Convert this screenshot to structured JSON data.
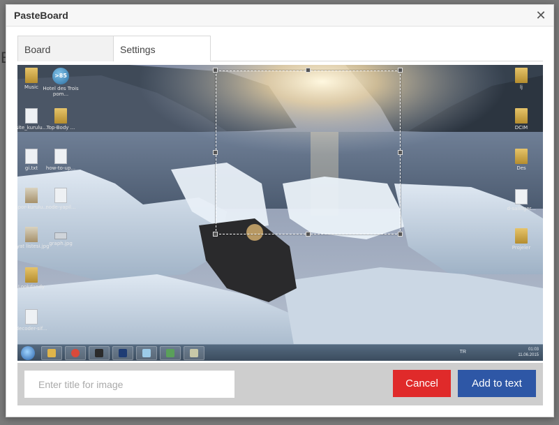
{
  "modal": {
    "title": "PasteBoard",
    "close_glyph": "✕"
  },
  "tabs": [
    {
      "label": "Board",
      "active": true
    },
    {
      "label": "Settings",
      "active": false
    }
  ],
  "desktop_icons": [
    {
      "label": "Music",
      "icon": "folder-icon"
    },
    {
      "label": "Hotel des Trois pom...",
      "icon": "app-icon"
    },
    {
      "label": "site_kurulu...",
      "icon": "file-icon"
    },
    {
      "label": "Top-Body ...",
      "icon": "folder-icon"
    },
    {
      "label": "gi.txt",
      "icon": "file-icon"
    },
    {
      "label": "how-to-up...",
      "icon": "file-icon"
    },
    {
      "label": "spor-kurulu...",
      "icon": "image-icon"
    },
    {
      "label": "node-yapil...",
      "icon": "file-icon"
    },
    {
      "label": "fiyat listesi.jpg",
      "icon": "image-icon"
    },
    {
      "label": "graph.jpg",
      "icon": "drive-icon"
    },
    {
      "label": "Lookdandy",
      "icon": "folder-icon"
    },
    {
      "label": "decoder-sif...",
      "icon": "file-icon"
    },
    {
      "label": "lj",
      "icon": "folder-icon"
    },
    {
      "label": "DCIM",
      "icon": "folder-icon"
    },
    {
      "label": "Des",
      "icon": "folder-icon"
    },
    {
      "label": "d-salinger...",
      "icon": "file-icon"
    },
    {
      "label": "Projeler",
      "icon": "folder-icon"
    }
  ],
  "taskbar": {
    "lang": "TR",
    "time": "01:03",
    "date": "11.06.2015",
    "app_icons": [
      "start-orb-icon",
      "explorer-icon",
      "chrome-icon",
      "terminal-icon",
      "photoshop-icon",
      "notepad-icon",
      "tools-icon",
      "paint-icon"
    ]
  },
  "footer": {
    "title_placeholder": "Enter title for image",
    "title_value": "",
    "cancel_label": "Cancel",
    "add_label": "Add to text"
  },
  "colors": {
    "cancel": "#e02a2a",
    "add": "#2e57a6",
    "footer_bg": "#cecece"
  }
}
